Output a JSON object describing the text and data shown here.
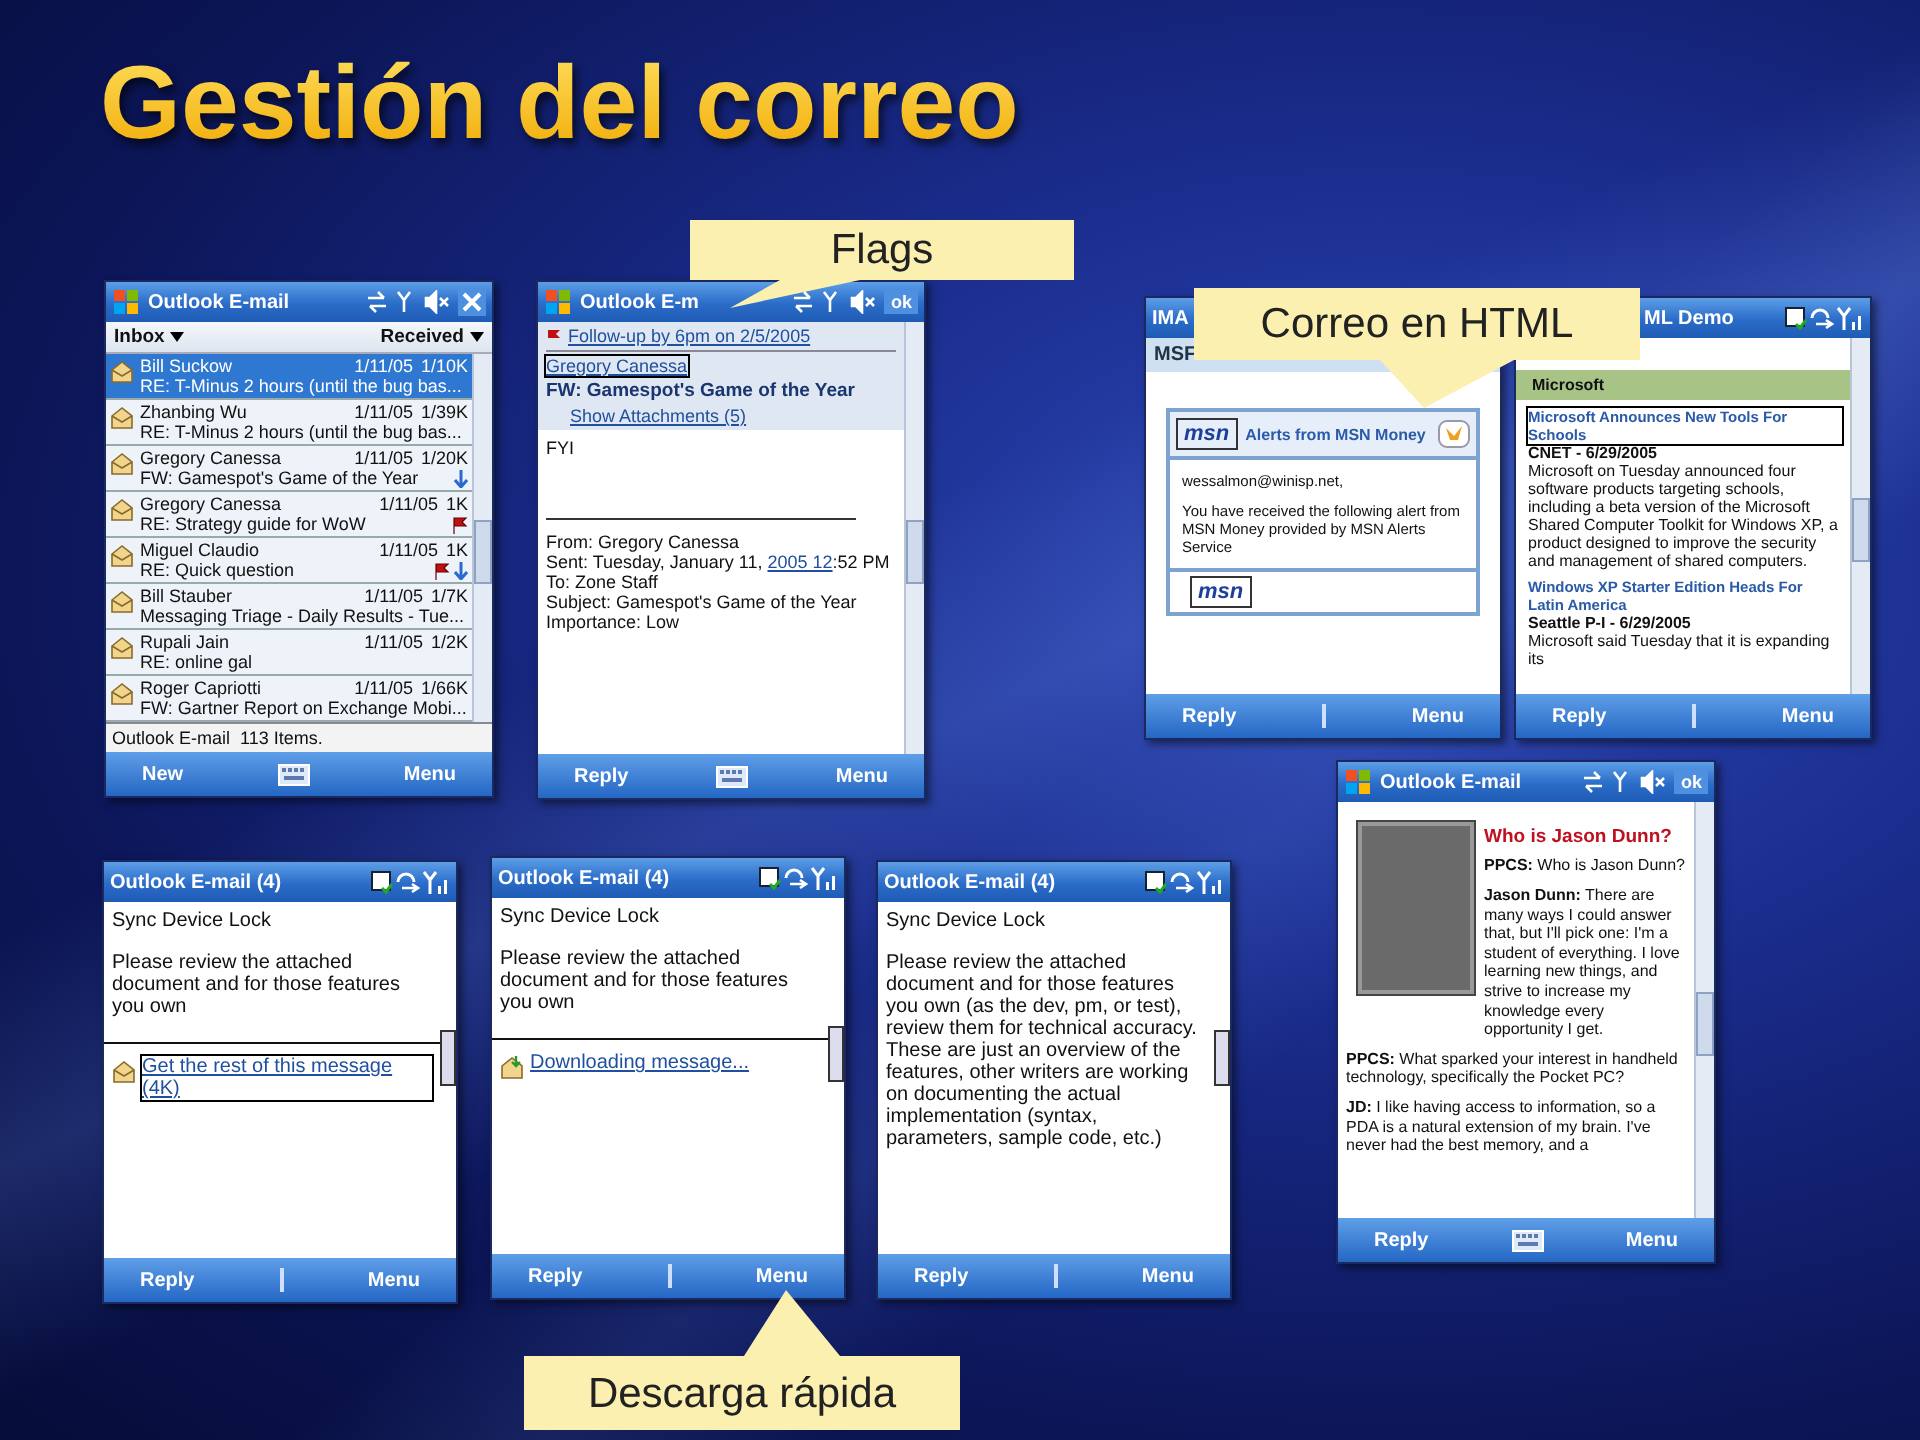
{
  "title": "Gestión del correo",
  "screens": [
    {
      "kind": "inbox",
      "title": "Outlook E-mail",
      "close": true,
      "filter": "Inbox",
      "sort": "Received",
      "rows": [
        {
          "sender": "Bill Suckow",
          "date": "1/11/05",
          "size": "1/10K",
          "subject": "RE: T-Minus 2 hours (until the bug bas...",
          "selected": true,
          "flagged": false,
          "download": false
        },
        {
          "sender": "Zhanbing Wu",
          "date": "1/11/05",
          "size": "1/39K",
          "subject": "RE: T-Minus 2 hours (until the bug bas...",
          "selected": false,
          "flagged": false,
          "download": false
        },
        {
          "sender": "Gregory Canessa",
          "date": "1/11/05",
          "size": "1/20K",
          "subject": "FW: Gamespot's Game of the Year",
          "selected": false,
          "flagged": false,
          "download": true
        },
        {
          "sender": "Gregory Canessa",
          "date": "1/11/05",
          "size": "1K",
          "subject": "RE: Strategy guide for WoW",
          "selected": false,
          "flagged": true,
          "download": false
        },
        {
          "sender": "Miguel Claudio",
          "date": "1/11/05",
          "size": "1K",
          "subject": "RE: Quick question",
          "selected": false,
          "flagged": true,
          "download": true
        },
        {
          "sender": "Bill Stauber",
          "date": "1/11/05",
          "size": "1/7K",
          "subject": "Messaging Triage - Daily Results - Tue...",
          "selected": false,
          "flagged": false,
          "download": false
        },
        {
          "sender": "Rupali Jain",
          "date": "1/11/05",
          "size": "1/2K",
          "subject": "RE: online gal",
          "selected": false,
          "flagged": false,
          "download": false
        },
        {
          "sender": "Roger Capriotti",
          "date": "1/11/05",
          "size": "1/66K",
          "subject": "FW: Gartner Report on Exchange Mobi...",
          "selected": false,
          "flagged": false,
          "download": false
        }
      ],
      "status": "Outlook E-mail  113 Items.",
      "softkeys": [
        "New",
        "Menu"
      ],
      "soft_input": true
    },
    {
      "kind": "message",
      "title": "Outlook E-m",
      "ok": "ok",
      "followup": "Follow-up by 6pm on 2/5/2005",
      "sender": "Gregory Canessa",
      "subject": "FW: Gamespot's Game of the Year",
      "attachments": "Show Attachments (5)",
      "body": "FYI",
      "headers": [
        {
          "text": "From: Gregory Canessa"
        },
        {
          "text": "Sent: Tuesday, January 11, ",
          "link": "2005 12",
          "after": ":52 PM"
        },
        {
          "text": "To: Zone Staff"
        },
        {
          "text": "Subject: Gamespot's Game of the Year"
        },
        {
          "text": "Importance: Low"
        }
      ],
      "softkeys": [
        "Reply",
        "Menu"
      ],
      "soft_input": true
    },
    {
      "kind": "alert",
      "title": "IMA",
      "ticker": "MSF",
      "logo": "msn",
      "card_title": "Alerts from MSN Money",
      "recipient": "wessalmon@winisp.net,",
      "message": "You have received the following alert from MSN Money provided by MSN Alerts Service",
      "footer_logo": "msn",
      "softkeys": [
        "Reply",
        "Menu"
      ],
      "soft_input": false
    },
    {
      "kind": "news",
      "title": "ML Demo",
      "section": "Microsoft",
      "stories": [
        {
          "headline": "Microsoft Announces New Tools For Schools",
          "focused": true,
          "source": "CNET - 6/29/2005",
          "summary": "Microsoft on Tuesday announced four software products targeting schools, including a beta version of the Microsoft Shared Computer Toolkit for Windows XP, a product designed to improve the security and management of shared computers."
        },
        {
          "headline": "Windows XP Starter Edition Heads For Latin America",
          "focused": false,
          "source": "Seattle P-I - 6/29/2005",
          "summary": "Microsoft said Tuesday that it is expanding its"
        }
      ],
      "softkeys": [
        "Reply",
        "Menu"
      ],
      "soft_input": false
    },
    {
      "kind": "partial",
      "title": "Outlook E-mail (4)",
      "subject": "Sync Device Lock",
      "body": "Please review the attached document and for those features you own",
      "footer": {
        "kind": "fetch",
        "text": "Get the rest of this message (4K)",
        "focused": true
      },
      "softkeys": [
        "Reply",
        "Menu"
      ],
      "soft_input": false
    },
    {
      "kind": "partial",
      "title": "Outlook E-mail (4)",
      "subject": "Sync Device Lock",
      "body": "Please review the attached document and for those features you own",
      "footer": {
        "kind": "downloading",
        "text": "Downloading message...",
        "focused": false
      },
      "softkeys": [
        "Reply",
        "Menu"
      ],
      "soft_input": false
    },
    {
      "kind": "partial",
      "title": "Outlook E-mail (4)",
      "subject": "Sync Device Lock",
      "body": "Please review the attached document and for those features you own (as the dev, pm, or test), review them for technical accuracy. These are just an overview of the features, other writers are working on documenting the actual implementation (syntax, parameters, sample code, etc.)",
      "softkeys": [
        "Reply",
        "Menu"
      ],
      "soft_input": false
    },
    {
      "kind": "article",
      "title": "Outlook E-mail",
      "ok": "ok",
      "heading": "Who is Jason Dunn?",
      "paragraphs": [
        "**PPCS:** Who is Jason Dunn?",
        "**Jason Dunn:** There are many ways I could answer that, but I'll pick one: I'm a student of everything. I love learning new things, and strive to increase my knowledge every opportunity I get.",
        "**PPCS:** What sparked your interest in handheld technology, specifically the Pocket PC?",
        "**JD:** I like having access to information, so a PDA is a natural extension of my brain. I've never had the best memory, and a"
      ],
      "softkeys": [
        "Reply",
        "Menu"
      ],
      "soft_input": true
    }
  ],
  "callouts": [
    {
      "text": "Flags"
    },
    {
      "text": "Correo en HTML"
    },
    {
      "text": "Descarga rápida"
    }
  ]
}
